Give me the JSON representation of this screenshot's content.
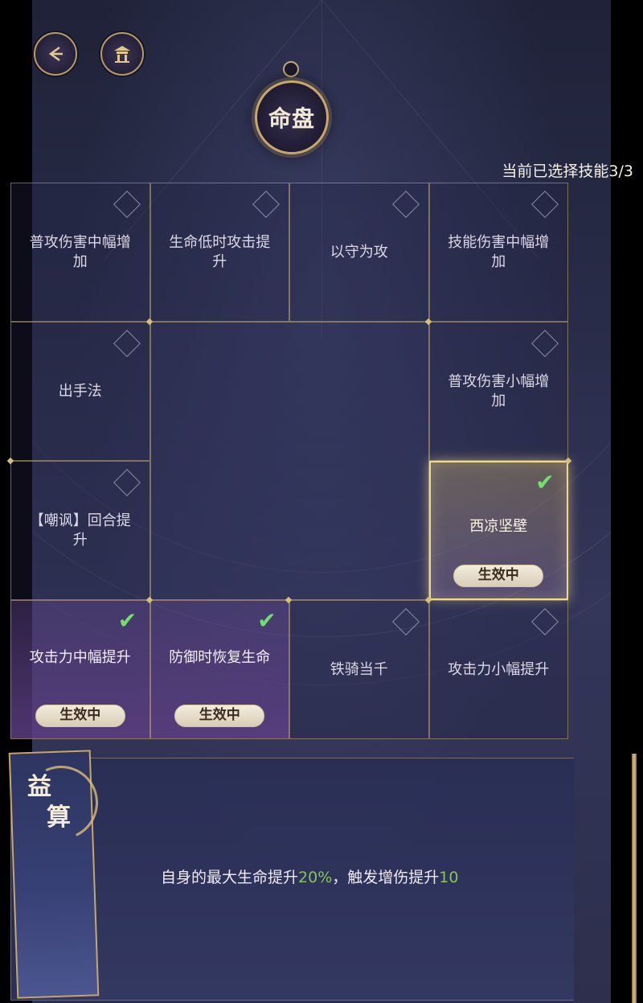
{
  "header": {
    "back_icon": "back-arrow-icon",
    "home_icon": "pavilion-icon",
    "title": "命盘",
    "skill_count": "当前已选择技能3/3"
  },
  "grid": {
    "cells": [
      {
        "label": "普攻伤害中幅增加",
        "state": "locked"
      },
      {
        "label": "生命低时攻击提升",
        "state": "locked"
      },
      {
        "label": "以守为攻",
        "state": "locked"
      },
      {
        "label": "技能伤害中幅增加",
        "state": "locked"
      },
      {
        "label": "出手法",
        "state": "locked"
      },
      {
        "label": "普攻伤害小幅增加",
        "state": "locked"
      },
      {
        "label": "【嘲讽】回合提升",
        "state": "locked"
      },
      {
        "label": "西凉坚壁",
        "state": "selected"
      },
      {
        "label": "攻击力中幅提升",
        "state": "selected"
      },
      {
        "label": "防御时恢复生命",
        "state": "selected"
      },
      {
        "label": "铁骑当千",
        "state": "locked"
      },
      {
        "label": "攻击力小幅提升",
        "state": "locked"
      }
    ],
    "active_label": "生效中"
  },
  "panel": {
    "tag": "益算",
    "desc_part1": "自身的最大生命提升",
    "desc_hl1": "20%",
    "desc_part2": "，触发增伤提升",
    "desc_hl2": "10"
  },
  "colors": {
    "gold": "#c9a76a",
    "check_green": "#6fe06b",
    "value_green": "#86c45a"
  }
}
